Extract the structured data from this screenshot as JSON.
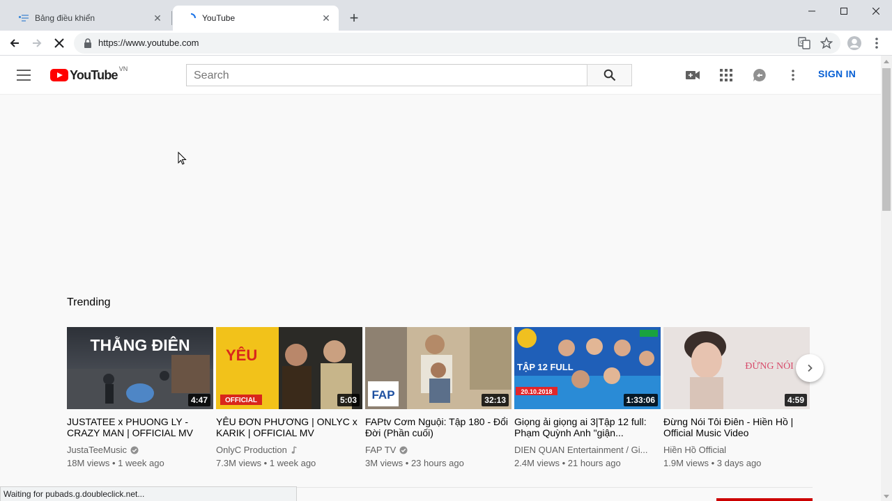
{
  "browser": {
    "tabs": [
      {
        "title": "Bảng điều khiển",
        "active": false
      },
      {
        "title": "YouTube",
        "active": true
      }
    ],
    "url": "https://www.youtube.com",
    "status": "Waiting for pubads.g.doubleclick.net..."
  },
  "header": {
    "logo_text": "YouTube",
    "region": "VN",
    "search_placeholder": "Search",
    "signin_label": "SIGN IN"
  },
  "trending": {
    "title": "Trending",
    "videos": [
      {
        "title": "JUSTATEE x PHUONG LY - CRAZY MAN | OFFICIAL MV",
        "channel": "JustaTeeMusic",
        "verified": true,
        "views": "18M views",
        "age": "1 week ago",
        "meta": "18M views • 1 week ago",
        "duration": "4:47",
        "thumb_text": "THẰNG ĐIÊN"
      },
      {
        "title": "YÊU ĐƠN PHƯƠNG | ONLYC x KARIK | OFFICIAL MV",
        "channel": "OnlyC Production",
        "verified": false,
        "music": true,
        "meta": "7.3M views • 1 week ago",
        "duration": "5:03",
        "thumb_text": "YÊU",
        "thumb_badge": "OFFICIAL"
      },
      {
        "title": "FAPtv Cơm Nguội: Tập 180 - Đổi Đời (Phần cuối)",
        "channel": "FAP TV",
        "verified": true,
        "meta": "3M views • 23 hours ago",
        "duration": "32:13",
        "thumb_text": "FAP"
      },
      {
        "title": "Giọng ải giọng ai 3|Tập 12 full: Phạm Quỳnh Anh \"giận...",
        "channel": "DIEN QUAN Entertainment / Gi...",
        "verified": false,
        "meta": "2.4M views • 21 hours ago",
        "duration": "1:33:06",
        "thumb_text": "TẬP 12 FULL",
        "thumb_date": "20.10.2018"
      },
      {
        "title": "Đừng Nói Tôi Điên - Hiền Hồ | Official Music Video",
        "channel": "Hiền Hồ Official",
        "verified": false,
        "meta": "1.9M views • 3 days ago",
        "duration": "4:59",
        "thumb_text": "ĐỪNG NÓI tôi điên"
      }
    ]
  },
  "colors": {
    "brand_red": "#ff0000",
    "link_blue": "#065fd4"
  }
}
